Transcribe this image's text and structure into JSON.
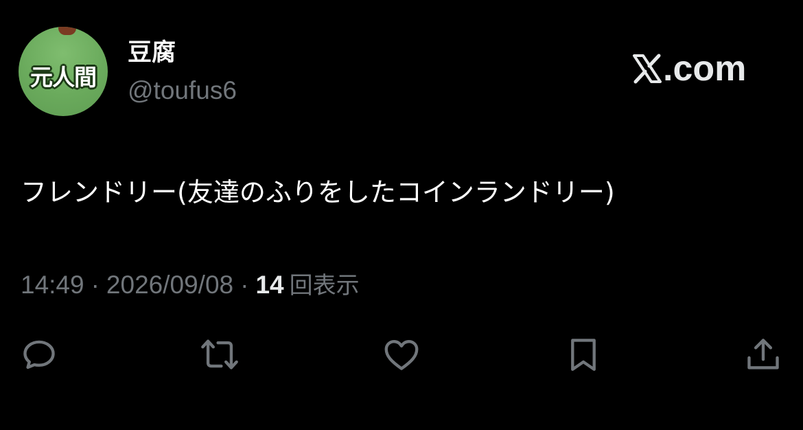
{
  "header": {
    "avatar_text": "元人間",
    "display_name": "豆腐",
    "handle": "@toufus6",
    "brand": ".com",
    "brand_icon": "x-logo-icon"
  },
  "tweet": {
    "text": "フレンドリー(友達のふりをしたコインランドリー)"
  },
  "meta": {
    "time": "14:49",
    "separator": "·",
    "date": "2026/09/08",
    "views_count": "14",
    "views_label": "回表示"
  },
  "actions": [
    {
      "name": "reply",
      "icon": "reply-icon"
    },
    {
      "name": "retweet",
      "icon": "retweet-icon"
    },
    {
      "name": "like",
      "icon": "heart-icon"
    },
    {
      "name": "bookmark",
      "icon": "bookmark-icon"
    },
    {
      "name": "share",
      "icon": "share-icon"
    }
  ],
  "colors": {
    "background": "#000000",
    "text_primary": "#ffffff",
    "text_secondary": "#71767b",
    "avatar_green": "#6aaa5c"
  }
}
